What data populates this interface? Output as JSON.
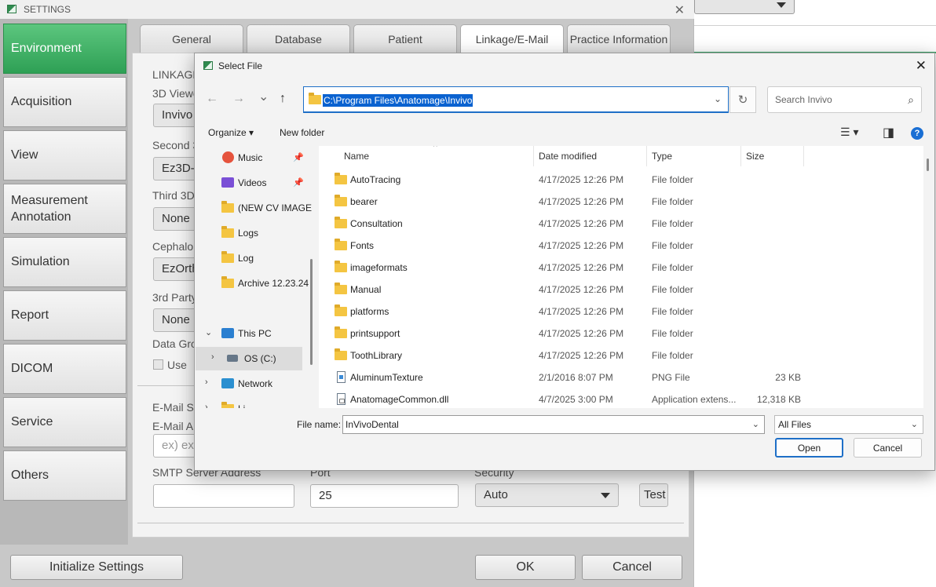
{
  "settings": {
    "title": "SETTINGS",
    "close": "✕",
    "sidebar": [
      {
        "label": "Environment",
        "active": true
      },
      {
        "label": "Acquisition"
      },
      {
        "label": "View"
      },
      {
        "label": "Measurement\nAnnotation"
      },
      {
        "label": "Simulation"
      },
      {
        "label": "Report"
      },
      {
        "label": "DICOM"
      },
      {
        "label": "Service"
      },
      {
        "label": "Others"
      }
    ],
    "tabs": [
      {
        "label": "General"
      },
      {
        "label": "Database"
      },
      {
        "label": "Patient"
      },
      {
        "label": "Linkage/E-Mail",
        "active": true
      },
      {
        "label": "Practice Information"
      }
    ],
    "content": {
      "linkage_label": "LINKAGE",
      "viewer3d_label": "3D Viewe",
      "viewer3d_value": "Invivo",
      "second3d_label": "Second 3",
      "second3d_value": "Ez3D-",
      "third3d_label": "Third 3D",
      "third3d_value": "None",
      "cephalo_label": "Cephalo",
      "cephalo_value": "EzOrth",
      "thirdparty_label": "3rd Party",
      "thirdparty_value": "None",
      "datagroup_label": "Data Gro",
      "use_label": "Use",
      "email_sender_label": "E-Mail Se",
      "email_addr_label": "E-Mail A",
      "email_addr_placeholder": "ex) exan",
      "smtp_label": "SMTP Server Address",
      "smtp_value": "",
      "port_label": "Port",
      "port_value": "25",
      "security_label": "Security",
      "security_value": "Auto",
      "test_label": "Test"
    },
    "footer": {
      "initialize": "Initialize Settings",
      "ok": "OK",
      "cancel": "Cancel"
    }
  },
  "dialog": {
    "title": "Select File",
    "close": "✕",
    "nav": {
      "back": "←",
      "forward": "→",
      "recent": "⌄",
      "up": "↑"
    },
    "address": "C:\\Program Files\\Anatomage\\Invivo",
    "address_chevron": "⌄",
    "refresh": "↻",
    "search_placeholder": "Search Invivo",
    "search_icon": "⌕",
    "toolbar": {
      "organize": "Organize ▾",
      "new_folder": "New folder",
      "view_icon": "☰ ▾",
      "pane_icon": "◨",
      "help": "?"
    },
    "navpane": [
      {
        "label": "Music",
        "icon": "music-icon",
        "color": "#e5533d",
        "pinned": true
      },
      {
        "label": "Videos",
        "icon": "video-icon",
        "color": "#7a4fd6",
        "pinned": true
      },
      {
        "label": "(NEW CV IMAGE",
        "icon": "folder-icon"
      },
      {
        "label": "Logs",
        "icon": "folder-icon"
      },
      {
        "label": "Log",
        "icon": "folder-icon"
      },
      {
        "label": "Archive 12.23.24",
        "icon": "folder-icon"
      },
      {
        "label": "This PC",
        "icon": "pc-icon",
        "expanded": true
      },
      {
        "label": "OS (C:)",
        "icon": "drive-icon",
        "selected": true
      },
      {
        "label": "Network",
        "icon": "network-icon"
      },
      {
        "label": "Li",
        "icon": "folder-icon"
      }
    ],
    "pin_glyph": "📌",
    "expand_glyph": "›",
    "expanded_glyph": "⌄",
    "columns": {
      "name": "Name",
      "date": "Date modified",
      "type": "Type",
      "size": "Size",
      "sort": "^"
    },
    "files": [
      {
        "name": "AutoTracing",
        "date": "4/17/2025 12:26 PM",
        "type": "File folder",
        "size": "",
        "kind": "folder"
      },
      {
        "name": "bearer",
        "date": "4/17/2025 12:26 PM",
        "type": "File folder",
        "size": "",
        "kind": "folder"
      },
      {
        "name": "Consultation",
        "date": "4/17/2025 12:26 PM",
        "type": "File folder",
        "size": "",
        "kind": "folder"
      },
      {
        "name": "Fonts",
        "date": "4/17/2025 12:26 PM",
        "type": "File folder",
        "size": "",
        "kind": "folder"
      },
      {
        "name": "imageformats",
        "date": "4/17/2025 12:26 PM",
        "type": "File folder",
        "size": "",
        "kind": "folder"
      },
      {
        "name": "Manual",
        "date": "4/17/2025 12:26 PM",
        "type": "File folder",
        "size": "",
        "kind": "folder"
      },
      {
        "name": "platforms",
        "date": "4/17/2025 12:26 PM",
        "type": "File folder",
        "size": "",
        "kind": "folder"
      },
      {
        "name": "printsupport",
        "date": "4/17/2025 12:26 PM",
        "type": "File folder",
        "size": "",
        "kind": "folder"
      },
      {
        "name": "ToothLibrary",
        "date": "4/17/2025 12:26 PM",
        "type": "File folder",
        "size": "",
        "kind": "folder"
      },
      {
        "name": "AluminumTexture",
        "date": "2/1/2016 8:07 PM",
        "type": "PNG File",
        "size": "23 KB",
        "kind": "png"
      },
      {
        "name": "AnatomageCommon.dll",
        "date": "4/7/2025 3:00 PM",
        "type": "Application extens...",
        "size": "12,318 KB",
        "kind": "dll"
      }
    ],
    "file_name_label": "File name:",
    "file_name_value": "InVivoDental",
    "file_type_value": "All Files",
    "chevron": "⌄",
    "open": "Open",
    "cancel": "Cancel"
  }
}
